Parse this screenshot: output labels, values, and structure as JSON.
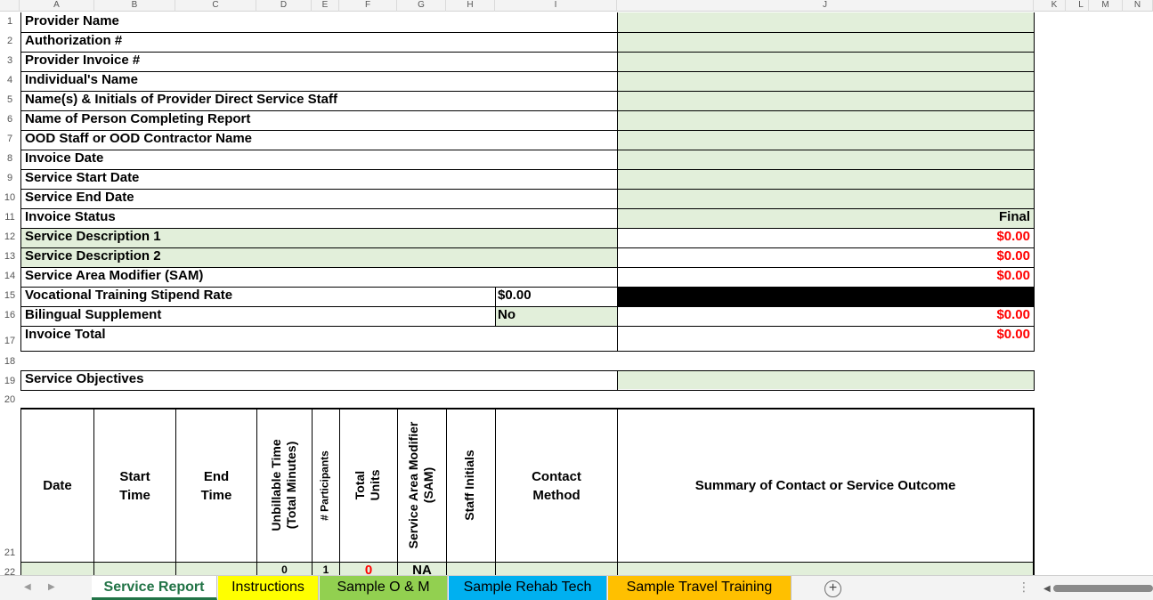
{
  "columns": [
    "A",
    "B",
    "C",
    "D",
    "E",
    "F",
    "G",
    "H",
    "I",
    "J",
    "K",
    "L",
    "M",
    "N"
  ],
  "rows": [
    "1",
    "2",
    "3",
    "4",
    "5",
    "6",
    "7",
    "8",
    "9",
    "10",
    "11",
    "12",
    "13",
    "14",
    "15",
    "16",
    "17",
    "18",
    "19",
    "20",
    "21",
    "22"
  ],
  "form": {
    "provider_name": "Provider Name",
    "authorization": "Authorization #",
    "provider_invoice": "Provider Invoice #",
    "individuals_name": "Individual's Name",
    "staff_names": "Name(s) & Initials of Provider Direct Service Staff",
    "person_completing": "Name of Person Completing Report",
    "ood_staff": "OOD Staff or OOD Contractor Name",
    "invoice_date": "Invoice Date",
    "service_start": "Service Start Date",
    "service_end": "Service End Date",
    "invoice_status": "Invoice Status",
    "invoice_status_value": "Final",
    "service_desc_1": "Service Description 1",
    "service_desc_1_value": "$0.00",
    "service_desc_2": "Service Description 2",
    "service_desc_2_value": "$0.00",
    "sam": "Service Area Modifier (SAM)",
    "sam_value": "$0.00",
    "stipend_rate": "Vocational Training Stipend Rate",
    "stipend_rate_value": "$0.00",
    "bilingual": "Bilingual Supplement",
    "bilingual_value": "No",
    "bilingual_amount": "$0.00",
    "invoice_total": "Invoice Total",
    "invoice_total_value": "$0.00",
    "service_objectives": "Service Objectives"
  },
  "table": {
    "headers": {
      "date": "Date",
      "start_1": "Start",
      "start_2": "Time",
      "end_1": "End",
      "end_2": "Time",
      "unbillable_1": "Unbillable Time",
      "unbillable_2": "(Total Minutes)",
      "participants": "# Participants",
      "units_1": "Total",
      "units_2": "Units",
      "sam_1": "Service Area Modifier",
      "sam_2": "(SAM)",
      "staff_initials": "Staff Initials",
      "contact_1": "Contact",
      "contact_2": "Method",
      "summary": "Summary of Contact or Service Outcome"
    },
    "first_row": {
      "unbillable": "0",
      "participants": "1",
      "units": "0",
      "sam": "NA"
    }
  },
  "tabs": [
    {
      "label": "Service Report",
      "color": "#ffffff"
    },
    {
      "label": "Instructions",
      "color": "#ffff00"
    },
    {
      "label": "Sample O & M",
      "color": "#92d050"
    },
    {
      "label": "Sample Rehab Tech",
      "color": "#00b0f0"
    },
    {
      "label": "Sample Travel Training",
      "color": "#ffc000"
    }
  ],
  "colors": {
    "input_fill": "#e2efda",
    "money_red": "#ff0000",
    "active_tab": "#217346"
  }
}
